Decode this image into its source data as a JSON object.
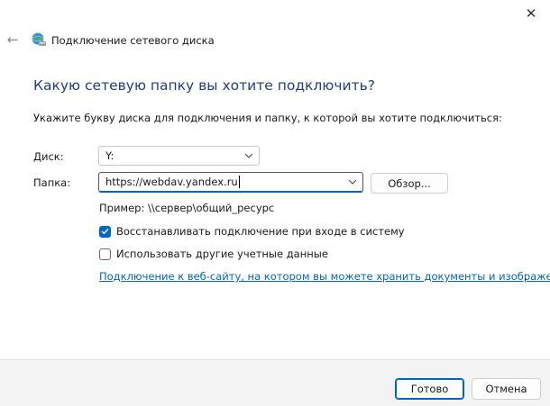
{
  "window": {
    "title": "Подключение сетевого диска",
    "close_glyph": "✕",
    "back_glyph": "←"
  },
  "page": {
    "heading": "Какую сетевую папку вы хотите подключить?",
    "description": "Укажите букву диска для подключения и папку, к которой вы хотите подключиться:"
  },
  "form": {
    "drive_label": "Диск:",
    "drive_value": "Y:",
    "folder_label": "Папка:",
    "folder_value": "https://webdav.yandex.ru",
    "browse_label": "Обзор...",
    "example_text": "Пример: \\\\сервер\\общий_ресурс",
    "reconnect_label": "Восстанавливать подключение при входе в систему",
    "reconnect_checked": true,
    "other_credentials_label": "Использовать другие учетные данные",
    "other_credentials_checked": false,
    "website_link": "Подключение к веб-сайту, на котором вы можете хранить документы и изображения",
    "link_trailing": "."
  },
  "footer": {
    "ok_label": "Готово",
    "cancel_label": "Отмена"
  },
  "colors": {
    "accent": "#0067c0",
    "heading": "#1f3d8a",
    "footer_bg": "#f3f3f3"
  }
}
